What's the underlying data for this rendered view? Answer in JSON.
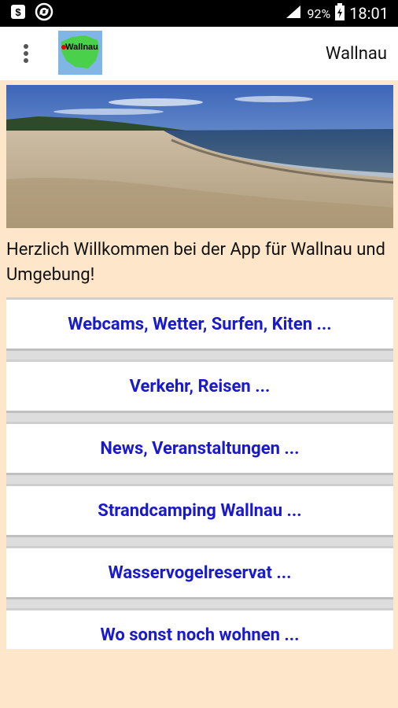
{
  "statusbar": {
    "battery": "92%",
    "time": "18:01"
  },
  "appbar": {
    "title": "Wallnau",
    "logo_text": "Wallnau"
  },
  "welcome": "Herzlich Willkommen bei der App für Wallnau und Umgebung!",
  "menu": [
    {
      "label": "Webcams, Wetter, Surfen, Kiten ..."
    },
    {
      "label": "Verkehr, Reisen ..."
    },
    {
      "label": "News, Veranstaltungen ..."
    },
    {
      "label": "Strandcamping Wallnau ..."
    },
    {
      "label": "Wasservogelreservat ..."
    },
    {
      "label": "Wo sonst noch wohnen ..."
    }
  ],
  "colors": {
    "background": "#fde6c9",
    "link": "#1a1acc",
    "statusbar": "#000000"
  }
}
